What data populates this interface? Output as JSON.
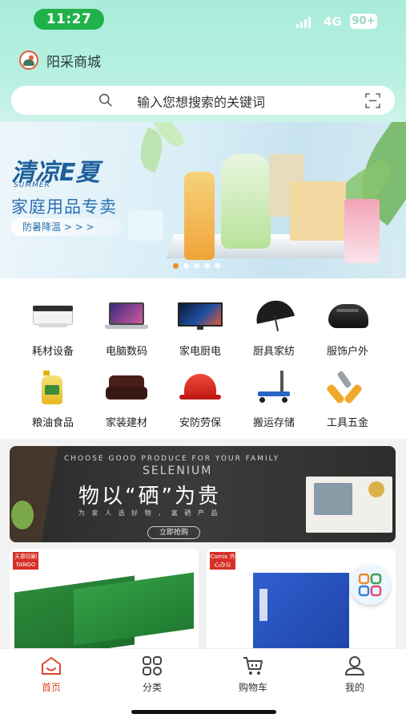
{
  "status_bar": {
    "time": "11:27",
    "network": "4G",
    "battery": "90+"
  },
  "header": {
    "brand": "阳采商城"
  },
  "search": {
    "placeholder": "输入您想搜索的关键词"
  },
  "banner": {
    "title": "清凉E夏",
    "subtitle_en": "SUMMER",
    "line2": "家庭用品专卖",
    "tag": "防暑降温 > > >",
    "slides": 5,
    "active_slide": 0
  },
  "categories": [
    {
      "label": "耗材设备",
      "icon": "printer-icon"
    },
    {
      "label": "电脑数码",
      "icon": "laptop-icon"
    },
    {
      "label": "家电厨电",
      "icon": "tv-icon"
    },
    {
      "label": "厨具家纺",
      "icon": "umbrella-icon"
    },
    {
      "label": "服饰户外",
      "icon": "helmet-icon"
    },
    {
      "label": "粮油食品",
      "icon": "oil-bottle-icon"
    },
    {
      "label": "家装建材",
      "icon": "sofa-icon"
    },
    {
      "label": "安防劳保",
      "icon": "hard-hat-icon"
    },
    {
      "label": "搬运存储",
      "icon": "hand-truck-icon"
    },
    {
      "label": "工具五金",
      "icon": "pliers-icon"
    }
  ],
  "promo": {
    "top": "CHOOSE GOOD PRODUCE FOR YOUR FAMILY",
    "subtitle": "SELENIUM",
    "main": "物以“硒”为贵",
    "sub": "为 家 人 选 好 物 ， 富 硒 产 品",
    "button": "立即抢购"
  },
  "products": [
    {
      "brand_badge": "天章印刷 TANGO"
    },
    {
      "brand_badge": "Comix 齐心办公"
    }
  ],
  "tabbar": [
    {
      "label": "首页",
      "icon": "home-icon",
      "active": true
    },
    {
      "label": "分类",
      "icon": "category-icon",
      "active": false
    },
    {
      "label": "购物车",
      "icon": "cart-icon",
      "active": false
    },
    {
      "label": "我的",
      "icon": "user-icon",
      "active": false
    }
  ],
  "colors": {
    "accent": "#e0452b",
    "header": "#b6f0e0",
    "time_pill": "#21b14a"
  }
}
